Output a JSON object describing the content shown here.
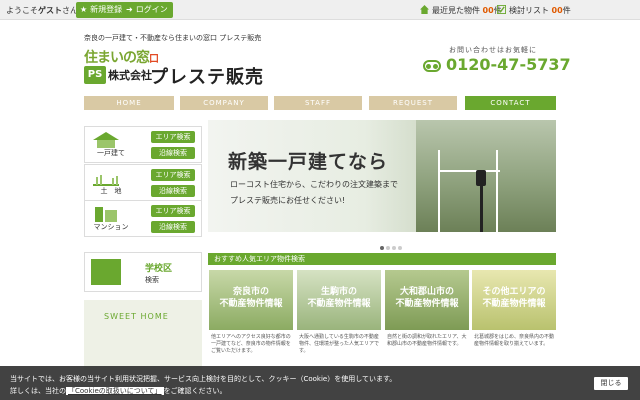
{
  "topbar": {
    "welcome_prefix": "ようこそ",
    "welcome_user": "ゲスト",
    "welcome_suffix": "さん",
    "register_label": "新規登録",
    "login_label": "ログイン",
    "recent_label": "最近見た物件",
    "recent_count": "00",
    "recent_unit": "件",
    "review_label": "検討リスト",
    "review_count": "00",
    "review_unit": "件"
  },
  "header": {
    "tagline": "奈良の一戸建て・不動産なら住まいの窓口 プレステ販売",
    "logo_line1": "住まいの窓",
    "logo_line1_suffix": "口",
    "logo_mark": "PS",
    "logo_company_prefix": "株式会社",
    "logo_company_name": "プレステ販売",
    "contact_label": "お問い合わせはお気軽に",
    "phone": "0120-47-5737"
  },
  "nav": [
    {
      "label": "HOME",
      "active": false
    },
    {
      "label": "COMPANY",
      "active": false
    },
    {
      "label": "STAFF",
      "active": false
    },
    {
      "label": "REQUEST",
      "active": false
    },
    {
      "label": "CONTACT",
      "active": true
    }
  ],
  "sidebar": {
    "boxes": [
      {
        "label": "一戸建て",
        "btn1": "エリア検索",
        "btn2": "沿線検索"
      },
      {
        "label": "土　地",
        "btn1": "エリア検索",
        "btn2": "沿線検索"
      },
      {
        "label": "マンション",
        "btn1": "エリア検索",
        "btn2": "沿線検索"
      }
    ],
    "school_line1": "学校区",
    "school_line2": "検索",
    "sweet_home": "SWEET HOME"
  },
  "hero": {
    "title": "新築一戸建てなら",
    "line1": "ローコスト住宅から、こだわりの注文建築まで",
    "line2": "プレステ販売にお任せください!",
    "slide_count": 4,
    "active_slide": 1
  },
  "section": {
    "title": "おすすめ人気エリア物件検索"
  },
  "cards": [
    {
      "t1": "奈良市の",
      "t2": "不動産物件情報",
      "desc": "他エリアへのアクセス良好な都市の一戸建てなど、奈良市の物件情報をご覧いただけます。"
    },
    {
      "t1": "生駒市の",
      "t2": "不動産物件情報",
      "desc": "大阪へ通勤している生駒市の不動産物件、住環境が整った人気エリアです。"
    },
    {
      "t1": "大和郡山市の",
      "t2": "不動産物件情報",
      "desc": "自然と街の調和が取れたエリア、大和郡山市の不動産物件情報です。"
    },
    {
      "t1": "その他エリアの",
      "t2": "不動産物件情報",
      "desc": "北葛城郡をはじめ、奈良県内の不動産物件情報を取り揃えています。"
    }
  ],
  "cookie": {
    "line1": "当サイトでは、お客様の当サイト利用状況把握、サービス向上検討を目的として、クッキー（Cookie）を使用しています。",
    "line2_prefix": "詳しくは、当社の",
    "line2_link": "「Cookieの取扱いについて」",
    "line2_suffix": "をご確認ください。",
    "close_label": "閉じる"
  },
  "colors": {
    "brand_green": "#6aa82f",
    "nav_tan": "#d9c9a4",
    "count_orange": "#e05a00"
  }
}
